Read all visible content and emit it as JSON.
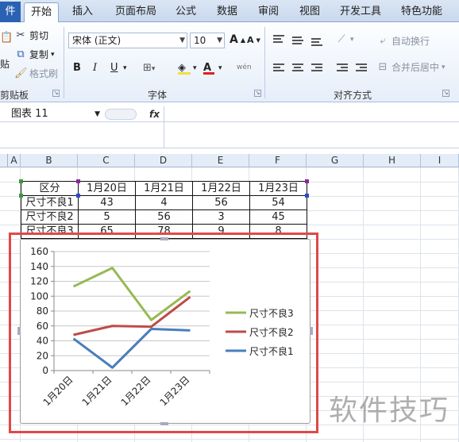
{
  "tabs": {
    "file": "件",
    "items": [
      "开始",
      "插入",
      "页面布局",
      "公式",
      "数据",
      "审阅",
      "视图",
      "开发工具",
      "特色功能"
    ],
    "active": "开始"
  },
  "clipboard": {
    "cut": "剪切",
    "copy": "复制",
    "format_painter": "格式刷",
    "paste_fragment": "贴",
    "group_label": "剪贴板"
  },
  "font": {
    "name": "宋体 (正文)",
    "size": "10",
    "grow_icon": "A",
    "shrink_icon": "A",
    "bold": "B",
    "italic": "I",
    "underline": "U",
    "font_color_letter": "A",
    "phonetic": "wén",
    "group_label": "字体"
  },
  "alignment": {
    "wrap_text": "自动换行",
    "merge_center": "合并后居中",
    "group_label": "对齐方式"
  },
  "formula_bar": {
    "name_box": "图表 11",
    "fx": "fx",
    "formula": ""
  },
  "columns": [
    "A",
    "B",
    "C",
    "D",
    "E",
    "F",
    "G",
    "H",
    "I"
  ],
  "table": {
    "header": [
      "区分",
      "1月20日",
      "1月21日",
      "1月22日",
      "1月23日"
    ],
    "rows": [
      [
        "尺寸不良1",
        "43",
        "4",
        "56",
        "54"
      ],
      [
        "尺寸不良2",
        "5",
        "56",
        "3",
        "45"
      ],
      [
        "尺寸不良3",
        "65",
        "78",
        "9",
        "8"
      ]
    ]
  },
  "chart_data": {
    "type": "line",
    "stacked": true,
    "categories": [
      "1月20日",
      "1月21日",
      "1月22日",
      "1月23日"
    ],
    "ylim": [
      0,
      160
    ],
    "yticks": [
      0,
      20,
      40,
      60,
      80,
      100,
      120,
      140,
      160
    ],
    "grid": true,
    "legend_position": "right",
    "series": [
      {
        "name": "尺寸不良1",
        "values": [
          43,
          4,
          56,
          54
        ],
        "color": "#4a7ebb"
      },
      {
        "name": "尺寸不良2",
        "values": [
          48,
          60,
          59,
          99
        ],
        "color": "#be4b48"
      },
      {
        "name": "尺寸不良3",
        "values": [
          113,
          138,
          68,
          107
        ],
        "color": "#98b954"
      }
    ],
    "legend_order": [
      "尺寸不良3",
      "尺寸不良2",
      "尺寸不良1"
    ]
  },
  "watermark": "软件技巧",
  "colors": {
    "accent": "#2a62b3",
    "selection_outline": "#e04848"
  }
}
